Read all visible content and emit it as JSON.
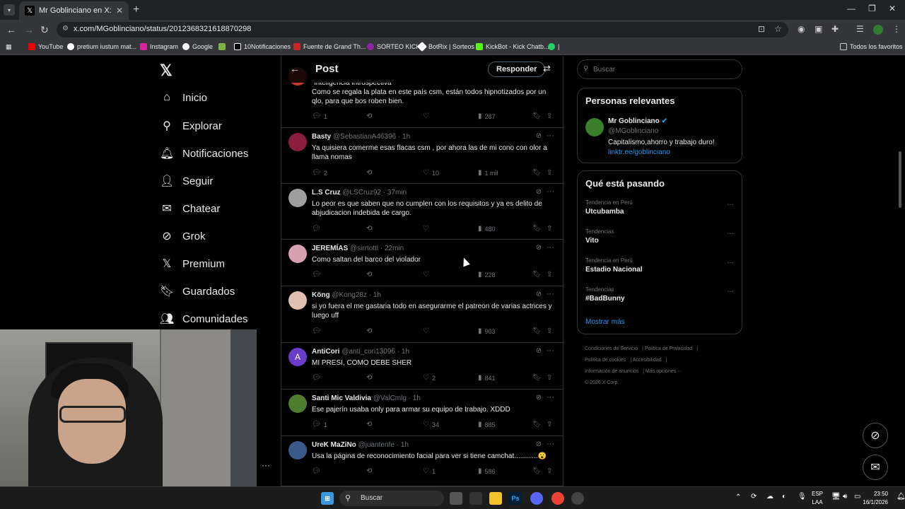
{
  "browser": {
    "tab_title": "Mr Goblinciano en X: \"QUE RIC",
    "url": "x.com/MGoblinciano/status/2012368321618870298",
    "bookmarks": [
      "YouTube",
      "pretium iustum mat...",
      "Instagram",
      "Google",
      "10Notificaciones",
      "Fuente de Grand Th...",
      "SORTEO KICK",
      "BotRix | Sorteos",
      "KickBot - Kick Chatb...",
      "Todos los favoritos"
    ]
  },
  "sidebar": {
    "items": [
      {
        "label": "Inicio",
        "icon": "home-icon"
      },
      {
        "label": "Explorar",
        "icon": "search-icon"
      },
      {
        "label": "Notificaciones",
        "icon": "bell-icon"
      },
      {
        "label": "Seguir",
        "icon": "follow-icon"
      },
      {
        "label": "Chatear",
        "icon": "mail-icon"
      },
      {
        "label": "Grok",
        "icon": "grok-icon"
      },
      {
        "label": "Premium",
        "icon": "x-icon"
      },
      {
        "label": "Guardados",
        "icon": "bookmark-icon"
      },
      {
        "label": "Comunidades",
        "icon": "communities-icon"
      }
    ]
  },
  "header": {
    "title": "Post",
    "reply_label": "Responder"
  },
  "tweets": [
    {
      "name": "",
      "handle": "",
      "time": "",
      "text": "Como se regala la plata en este país csm, están todos hipnotizados por un qlo, para que bos roben bien.",
      "pre": "\"inteligencia introspectiva\"",
      "replies": "1",
      "retweets": "",
      "likes": "",
      "views": "287"
    },
    {
      "name": "Basty",
      "handle": "@SebastianA46396 · 1h",
      "text": "Ya quisiera comerme esas flacas csm , por ahora las de mi cono con olor a llama nomas",
      "replies": "2",
      "retweets": "",
      "likes": "10",
      "views": "1 mil"
    },
    {
      "name": "L.S Cruz",
      "handle": "@LSCruz92 · 37min",
      "text": "Lo peor es que saben que no cumplen con los requisitos y ya es delito de abjudicacion indebida de cargo.",
      "replies": "",
      "retweets": "",
      "likes": "",
      "views": "480"
    },
    {
      "name": "JEREMÍAS",
      "handle": "@sirrtottl · 22min",
      "text": "Como saltan del barco del violador",
      "replies": "",
      "retweets": "",
      "likes": "",
      "views": "228"
    },
    {
      "name": "Köng",
      "handle": "@Kong28z · 1h",
      "text": "si yo fuera el me gastaria todo en asegurarme el patreon de varias actrices y luego uff",
      "replies": "",
      "retweets": "",
      "likes": "",
      "views": "903"
    },
    {
      "name": "AntiCori",
      "handle": "@anti_cori13096 · 1h",
      "text": "MI PRESI, COMO DEBE SHER",
      "replies": "",
      "retweets": "",
      "likes": "2",
      "views": "841"
    },
    {
      "name": "Santi Mic Valdivia",
      "handle": "@ValCmlg · 1h",
      "text": "Ese pajerín usaba only para armar su equipo de trabajo. XDDD",
      "replies": "1",
      "retweets": "",
      "likes": "34",
      "views": "885"
    },
    {
      "name": "UreK MaZiNo",
      "handle": "@juantenfe · 1h",
      "text": "Usa la página de reconocimiento facial para ver si tiene camchat............😮",
      "replies": "",
      "retweets": "",
      "likes": "1",
      "views": "586"
    }
  ],
  "right": {
    "search_placeholder": "Buscar",
    "relevant_title": "Personas relevantes",
    "profile": {
      "name": "Mr Goblinciano",
      "handle": "@MGoblinciano",
      "bio": "Capitalismo,ahorro y trabajo duro!",
      "link": "linktr.ee/goblinciano"
    },
    "trending_title": "Qué está pasando",
    "trends": [
      {
        "context": "Tendencia en Perú",
        "name": "Utcubamba"
      },
      {
        "context": "Tendencias",
        "name": "Vito"
      },
      {
        "context": "Tendencia en Perú",
        "name": "Estadio Nacional"
      },
      {
        "context": "Tendencias",
        "name": "#BadBunny"
      }
    ],
    "show_more": "Mostrar más",
    "footer": [
      "Condiciones de Servicio",
      "Política de Privacidad",
      "Política de cookies",
      "Accesibilidad",
      "Información de anuncios",
      "Más opciones ···",
      "© 2026 X Corp."
    ]
  },
  "taskbar": {
    "search": "Buscar",
    "lang1": "ESP",
    "lang2": "LAA",
    "time": "23:50",
    "date": "16/1/2026"
  },
  "colors": {
    "accent": "#1d9bf0",
    "bg": "#000000",
    "border": "#2f3336",
    "muted": "#71767b"
  }
}
